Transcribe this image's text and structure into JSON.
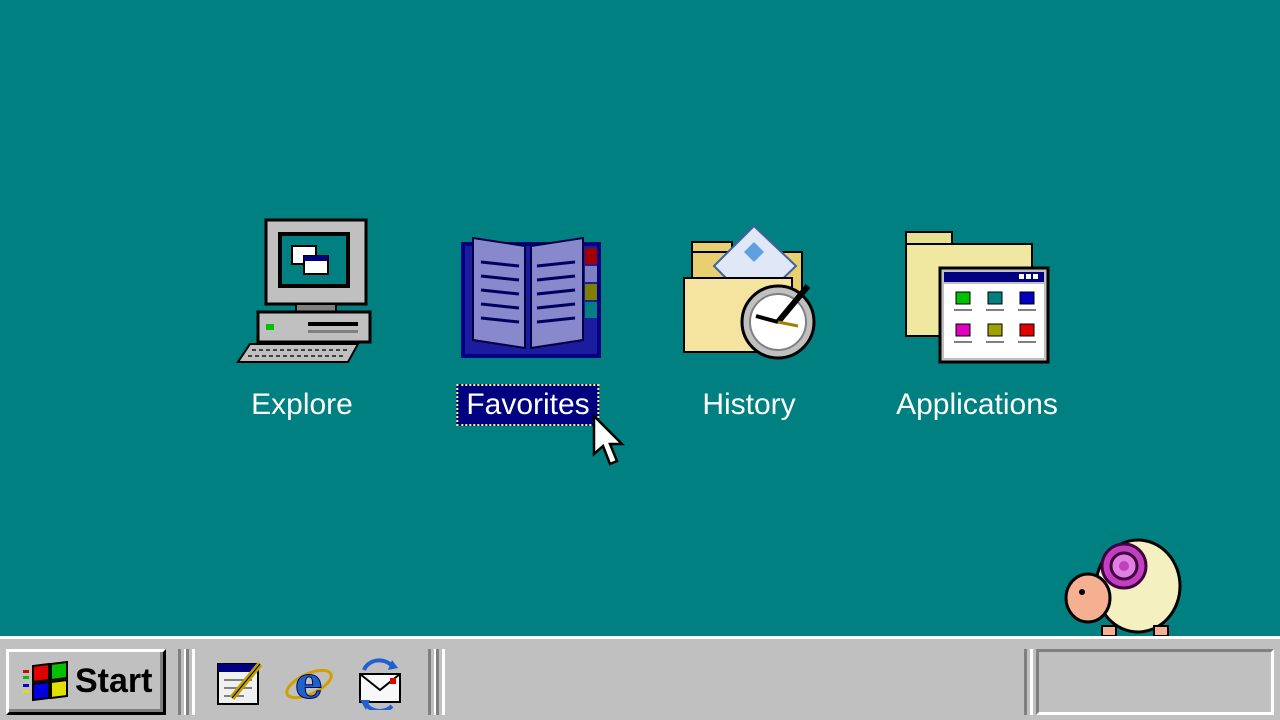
{
  "desktop": {
    "background_color": "#008080",
    "icons": [
      {
        "label": "Explore",
        "icon": "computer-icon"
      },
      {
        "label": "Favorites",
        "icon": "open-book-icon",
        "selected": true
      },
      {
        "label": "History",
        "icon": "folder-clock-icon"
      },
      {
        "label": "Applications",
        "icon": "applications-folder-icon"
      }
    ]
  },
  "taskbar": {
    "start_label": "Start",
    "quick_launch": [
      {
        "icon": "edit-document-icon"
      },
      {
        "icon": "internet-explorer-icon"
      },
      {
        "icon": "email-sync-icon"
      }
    ]
  },
  "colors": {
    "taskbar": "#c0c0c0",
    "selection": "#000080"
  }
}
